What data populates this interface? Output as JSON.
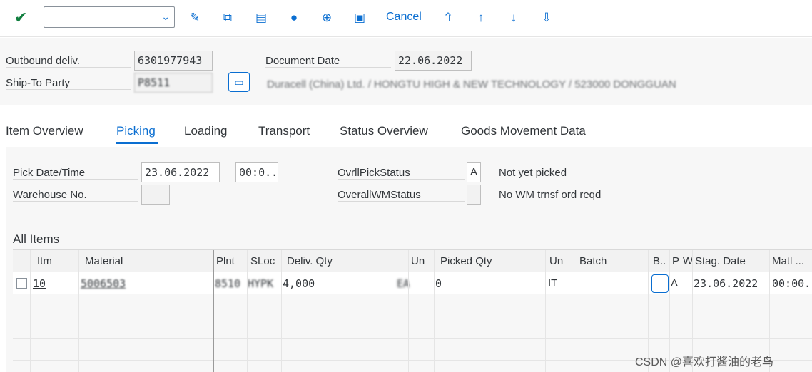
{
  "toolbar": {
    "check_icon": "checkmark-icon",
    "combo_value": "",
    "icons": [
      "edit-icon",
      "copy-icon",
      "document-icon",
      "hat-icon",
      "package-icon",
      "save-icon"
    ],
    "cancel_label": "Cancel",
    "nav_icons": [
      "first-page-icon",
      "previous-page-icon",
      "next-page-icon",
      "last-page-icon"
    ]
  },
  "header": {
    "outbound_label": "Outbound deliv.",
    "outbound_value": "6301977943",
    "doc_date_label": "Document Date",
    "doc_date_value": "22.06.2022",
    "ship_to_label": "Ship-To Party",
    "ship_to_value": "P8511",
    "ship_to_name": "Duracell (China) Ltd. / HONGTU HIGH & NEW TECHNOLOGY / 523000 DONGGUAN"
  },
  "tabs": [
    "Item Overview",
    "Picking",
    "Loading",
    "Transport",
    "Status Overview",
    "Goods Movement Data"
  ],
  "active_tab": "Picking",
  "picking": {
    "pick_date_label": "Pick Date/Time",
    "pick_date_value": "23.06.2022",
    "pick_time_value": "00:0..",
    "warehouse_label": "Warehouse No.",
    "warehouse_value": "",
    "ovrl_pick_label": "OvrllPickStatus",
    "ovrl_pick_value": "A",
    "ovrl_pick_text": "Not yet picked",
    "overall_wm_label": "OverallWMStatus",
    "overall_wm_value": "",
    "overall_wm_text": "No WM trnsf ord reqd"
  },
  "table": {
    "title": "All Items",
    "columns": [
      "Itm",
      "Material",
      "Plnt",
      "SLoc",
      "Deliv. Qty",
      "Un",
      "Picked Qty",
      "Un",
      "Batch",
      "B..",
      "P",
      "W",
      "Stag. Date",
      "Matl ..."
    ],
    "rows": [
      {
        "itm": "10",
        "material": "5006503",
        "plnt": "8510",
        "sloc": "HYPK",
        "deliv_qty": "4,000",
        "un": "EA",
        "picked_qty": "0",
        "un2": "IT",
        "batch": "",
        "p": "A",
        "stag_date": "23.06.2022",
        "matl_time": "00:00."
      }
    ]
  },
  "watermark": "CSDN @喜欢打酱油的老鸟"
}
